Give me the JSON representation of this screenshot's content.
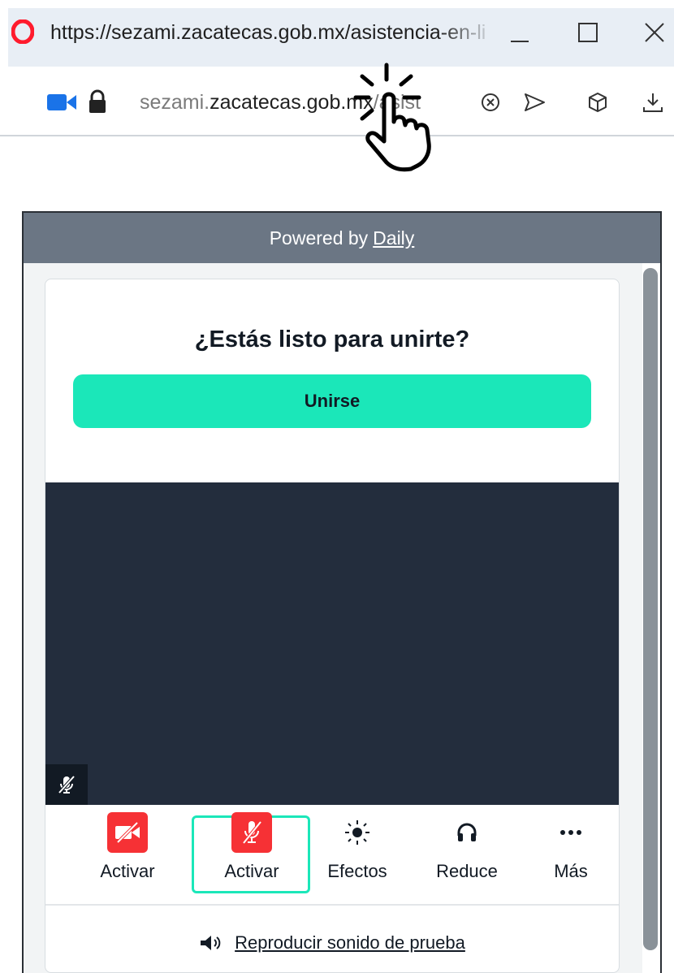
{
  "browser": {
    "tab_url": "https://sezami.zacatecas.gob.mx/asistencia-en-li",
    "address": {
      "subdomain": "sezami.",
      "domain": "zacatecas.gob.mx",
      "path": "/asist"
    },
    "icons": [
      "opera-logo",
      "camera-icon",
      "lock-icon",
      "close-circle-icon",
      "send-icon",
      "cube-icon",
      "download-icon",
      "minimize-icon",
      "maximize-icon",
      "close-icon"
    ]
  },
  "prejoin": {
    "powered_prefix": "Powered by",
    "powered_link": "Daily",
    "heading": "¿Estás listo para unirte?",
    "join_label": "Unirse",
    "controls": [
      {
        "label": "Activar",
        "icon": "camera-off-icon"
      },
      {
        "label": "Activar",
        "icon": "mic-off-icon"
      },
      {
        "label": "Efectos",
        "icon": "sun-icon"
      },
      {
        "label": "Reduce",
        "icon": "headphones-icon"
      },
      {
        "label": "Más",
        "icon": "more-icon"
      }
    ],
    "test_sound_label": "Reproducir sonido de prueba"
  },
  "colors": {
    "accent": "#1be7b9",
    "danger": "#f63135",
    "video_bg": "#232d3d",
    "header_bg": "#6b7684"
  }
}
